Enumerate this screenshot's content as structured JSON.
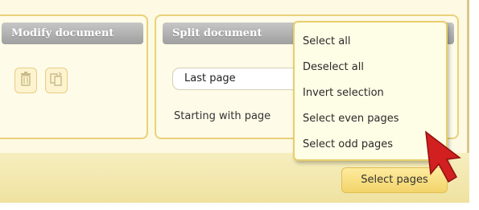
{
  "panels": {
    "modify": {
      "title": "Modify document",
      "buttons": [
        {
          "icon": "trash-icon",
          "label": ""
        },
        {
          "icon": "rotate-pages-icon",
          "label": ""
        }
      ]
    },
    "split": {
      "title": "Split document",
      "select_value": "Last page",
      "starting_label": "Starting with page"
    }
  },
  "context_menu": {
    "items": [
      {
        "label": "Select all"
      },
      {
        "label": "Deselect all"
      },
      {
        "label": "Invert selection"
      },
      {
        "label": "Select even pages"
      },
      {
        "label": "Select odd pages"
      }
    ]
  },
  "footer": {
    "select_pages_label": "Select pages"
  },
  "colors": {
    "panel_border": "#e8d27a",
    "header_gray": "#b3b3b3",
    "button_yellow": "#f3d46a",
    "cursor_red": "#d21f1f"
  }
}
